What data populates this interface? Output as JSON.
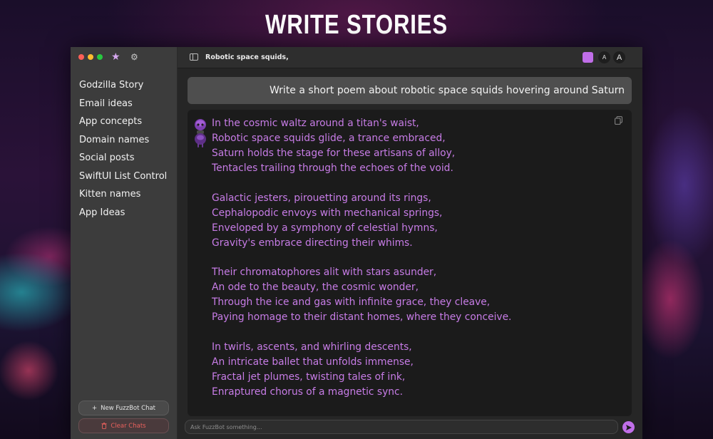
{
  "banner": {
    "title": "WRITE STORIES"
  },
  "sidebar": {
    "chats": [
      "Godzilla Story",
      "Email ideas",
      "App concepts",
      "Domain names",
      "Social posts",
      "SwiftUI List Control",
      "Kitten names",
      "App Ideas"
    ],
    "new_chat_label": "New FuzzBot Chat",
    "clear_chats_label": "Clear Chats",
    "new_chat_icon": "+"
  },
  "toolbar": {
    "chat_title": "Robotic space squids,",
    "font_small_label": "A",
    "font_large_label": "A",
    "accent_color": "#c06ee8"
  },
  "conversation": {
    "user_message": "Write a short poem about robotic space squids hovering around Saturn",
    "bot_stanzas": [
      [
        "In the cosmic waltz around a titan's waist,",
        "Robotic space squids glide, a trance embraced,",
        "Saturn holds the stage for these artisans of alloy,",
        "Tentacles trailing through the echoes of the void."
      ],
      [
        "Galactic jesters, pirouetting around its rings,",
        "Cephalopodic envoys with mechanical springs,",
        "Enveloped by a symphony of celestial hymns,",
        "Gravity's embrace directing their whims."
      ],
      [
        "Their chromatophores alit with stars asunder,",
        "An ode to the beauty, the cosmic wonder,",
        "Through the ice and gas with infinite grace, they cleave,",
        "Paying homage to their distant homes, where they conceive."
      ],
      [
        "In twirls, ascents, and whirling descents,",
        "An intricate ballet that unfolds immense,",
        "Fractal jet plumes, twisting tales of ink,",
        "Enraptured chorus of a magnetic sync."
      ]
    ],
    "poem_color": "#c77ce6"
  },
  "input": {
    "placeholder": "Ask FuzzBot something..."
  }
}
